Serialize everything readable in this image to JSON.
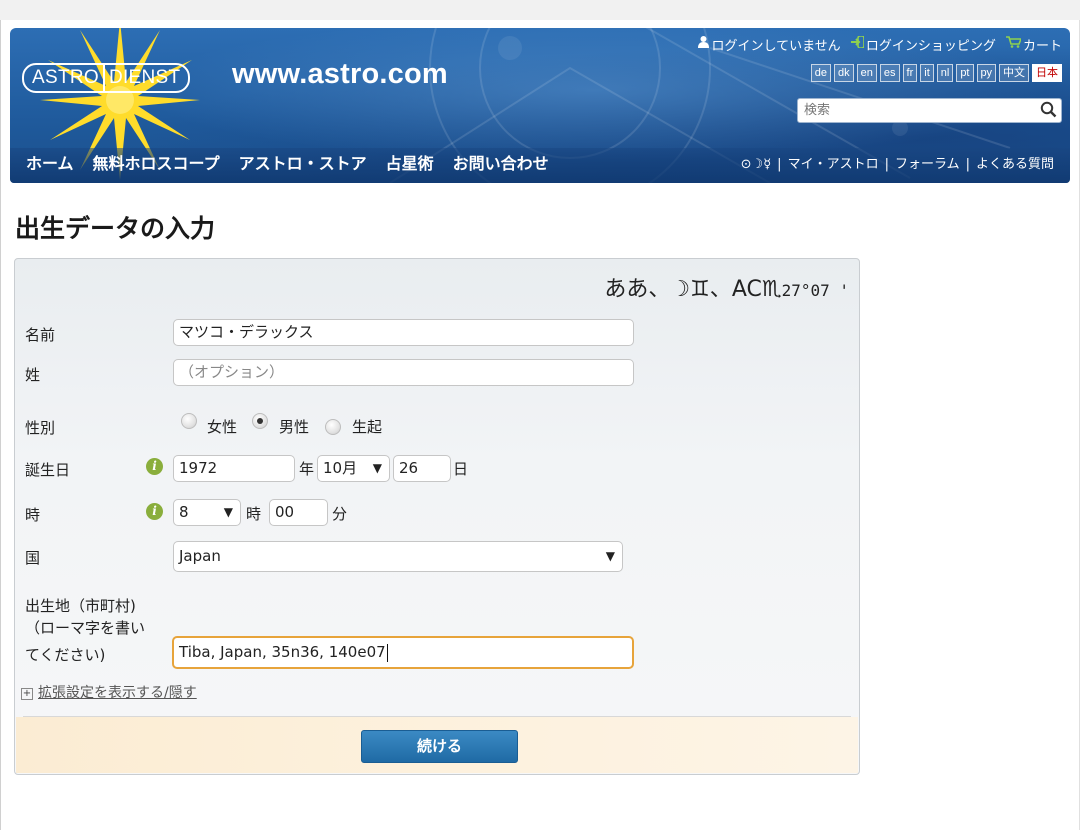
{
  "header": {
    "logo_left": "ASTRO",
    "logo_right": "DIENST",
    "site_url": "www.astro.com",
    "login_status": "ログインしていません",
    "login_shopping": "ログインショッピング",
    "cart": "カート",
    "languages": [
      "de",
      "dk",
      "en",
      "es",
      "fr",
      "it",
      "nl",
      "pt",
      "ру",
      "中文",
      "日本"
    ],
    "active_language": "日本",
    "search_placeholder": "検索",
    "nav_left": [
      "ホーム",
      "無料ホロスコープ",
      "アストロ・ストア",
      "占星術",
      "お問い合わせ"
    ],
    "nav_symbols": "⊙☽☿",
    "nav_right": [
      "マイ・アストロ",
      "フォーラム",
      "よくある質問"
    ]
  },
  "page": {
    "title": "出生データの入力"
  },
  "form": {
    "horoscope_summary": "ああ、☽♊、",
    "horoscope_ac": "AC♏",
    "horoscope_degree": "27°07 '",
    "name_label": "名前",
    "name_value": "マツコ・デラックス",
    "surname_label": "姓",
    "surname_placeholder": "（オプション）",
    "gender_label": "性別",
    "gender_options": [
      "女性",
      "男性",
      "生起"
    ],
    "gender_selected": "男性",
    "birthdate_label": "誕生日",
    "birth_year": "1972",
    "year_unit": "年",
    "birth_month": "10月",
    "birth_day": "26",
    "day_unit": "日",
    "time_label": "時",
    "birth_hour": "8",
    "hour_unit": "時",
    "birth_minute": "00",
    "minute_unit": "分",
    "country_label": "国",
    "country_value": "Japan",
    "place_label_1": "出生地（市町村)",
    "place_label_2": "（ローマ字を書い",
    "place_label_3": "てください)",
    "place_value": "Tiba, Japan, 35n36, 140e07",
    "extended_settings": "拡張設定を表示する/隠す",
    "continue_button": "続ける"
  },
  "colors": {
    "header_blue": "#1f5a9c",
    "button_blue": "#1f6aa5",
    "footer_bar": "#fdf1dd",
    "info_icon_green": "#8aae3c",
    "focus_border": "#e7a43b",
    "active_language_red": "#c00000"
  }
}
